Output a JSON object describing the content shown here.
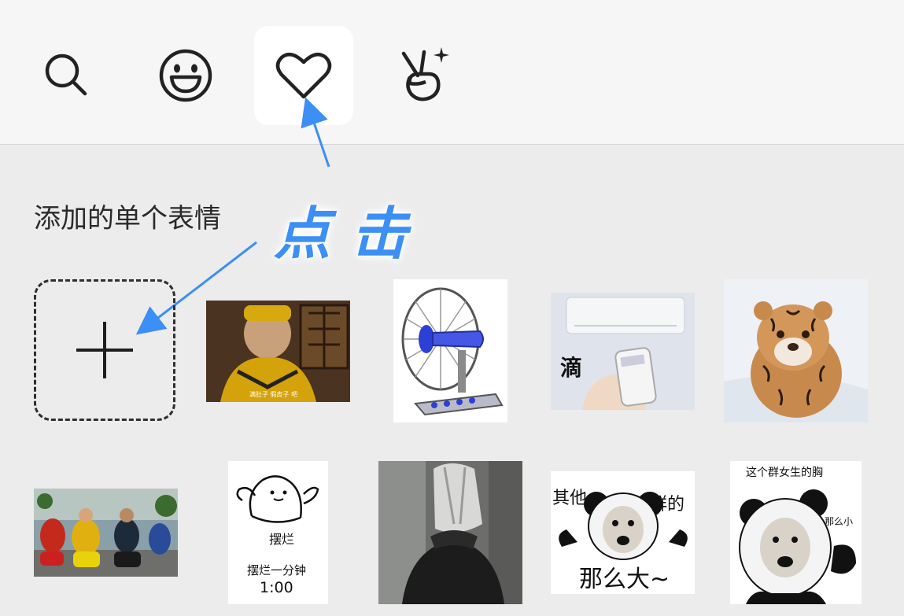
{
  "tabs": [
    {
      "id": "search",
      "icon": "search-icon",
      "active": false
    },
    {
      "id": "emoji",
      "icon": "smiley-icon",
      "active": false
    },
    {
      "id": "favorites",
      "icon": "heart-icon",
      "active": true
    },
    {
      "id": "gestures",
      "icon": "victory-hand-icon",
      "active": false
    }
  ],
  "section": {
    "title": "添加的单个表情"
  },
  "annotation": {
    "text": "点击",
    "color": "#3c8ff4"
  },
  "add_tile": {
    "icon": "plus-icon"
  },
  "stickers": [
    {
      "name": "sticker-monk",
      "caption": ""
    },
    {
      "name": "sticker-fan",
      "caption": ""
    },
    {
      "name": "sticker-ac-remote",
      "caption": "滴"
    },
    {
      "name": "sticker-tiger",
      "caption": ""
    },
    {
      "name": "sticker-scooter-crew",
      "caption": ""
    },
    {
      "name": "sticker-give-up",
      "caption_top": "摆烂",
      "caption_mid": "摆烂一分钟",
      "caption_bottom": "1:00"
    },
    {
      "name": "sticker-masked-person",
      "caption": ""
    },
    {
      "name": "sticker-panda-1",
      "caption_left": "其他",
      "caption_right": "群的",
      "caption_bottom": "那么大~"
    },
    {
      "name": "sticker-panda-2",
      "caption_top": "这个群女生的胸",
      "caption_right": "那么小"
    }
  ],
  "colors": {
    "accent": "#3c8ff4",
    "topbar": "#f6f6f6",
    "background": "#ececec"
  }
}
